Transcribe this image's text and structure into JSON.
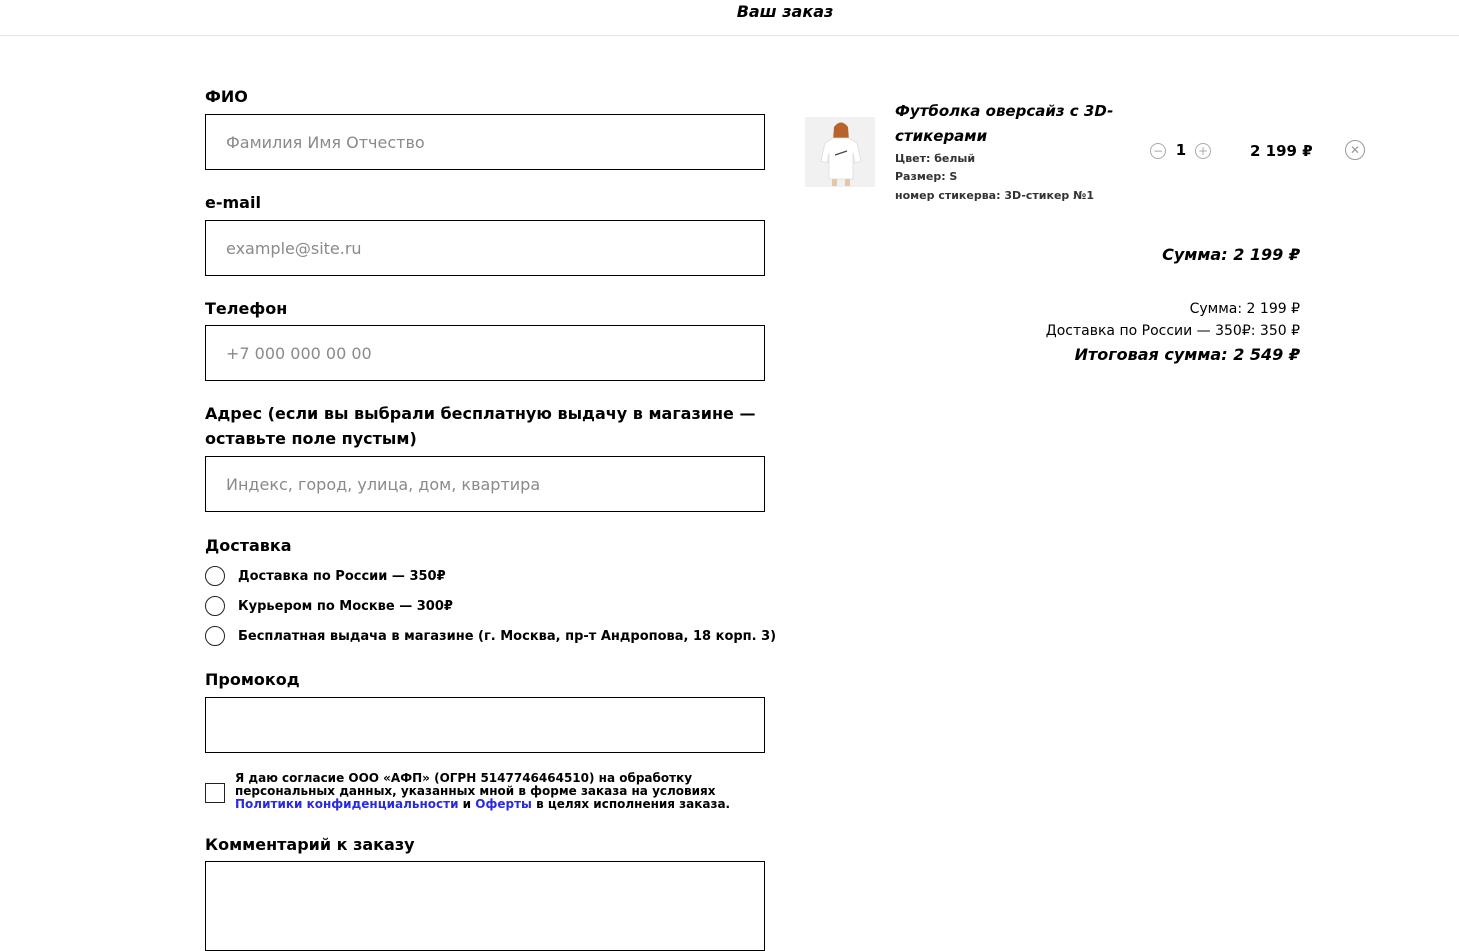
{
  "header": {
    "title": "Ваш заказ"
  },
  "form": {
    "fio_label": "ФИО",
    "fio_placeholder": "Фамилия Имя Отчество",
    "email_label": "e-mail",
    "email_placeholder": "example@site.ru",
    "phone_label": "Телефон",
    "phone_placeholder": "+7 000 000 00 00",
    "address_label_line1": "Адрес (если вы выбрали бесплатную выдачу в магазине —",
    "address_label_line2": "оставьте поле пустым)",
    "address_placeholder": "Индекс, город, улица, дом, квартира",
    "delivery_label": "Доставка",
    "delivery_options": [
      "Доставка по России — 350₽",
      "Курьером по Москве — 300₽",
      "Бесплатная выдача в магазине (г. Москва, пр-т Андропова, 18 корп. 3)"
    ],
    "promo_label": "Промокод",
    "consent_text_1": "Я даю согласие ООО «АФП» (ОГРН 5147746464510) на обработку персональных данных, указанных мной в форме заказа на условиях ",
    "consent_link_privacy": "Политики конфиденциальности",
    "consent_and": " и ",
    "consent_link_offer": "Оферты",
    "consent_text_2": " в целях исполнения заказа.",
    "comment_label": "Комментарий к заказу"
  },
  "cart": {
    "item": {
      "title": "Футболка оверсайз с 3D-стикерами",
      "color": "Цвет: белый",
      "size": "Размер: S",
      "sticker": "номер стикерва: 3D-стикер №1",
      "quantity": "1",
      "price": "2 199 ₽",
      "minus_glyph": "−",
      "plus_glyph": "+",
      "remove_glyph": "✕"
    },
    "subtotal_bold": "Сумма: 2 199 ₽",
    "subtotal": "Сумма: 2 199 ₽",
    "delivery": "Доставка по России — 350₽: 350 ₽",
    "total": "Итоговая сумма: 2 549 ₽"
  },
  "colors": {
    "link": "#2b2bdd",
    "border": "#000000",
    "placeholder": "#8a8a8a"
  }
}
